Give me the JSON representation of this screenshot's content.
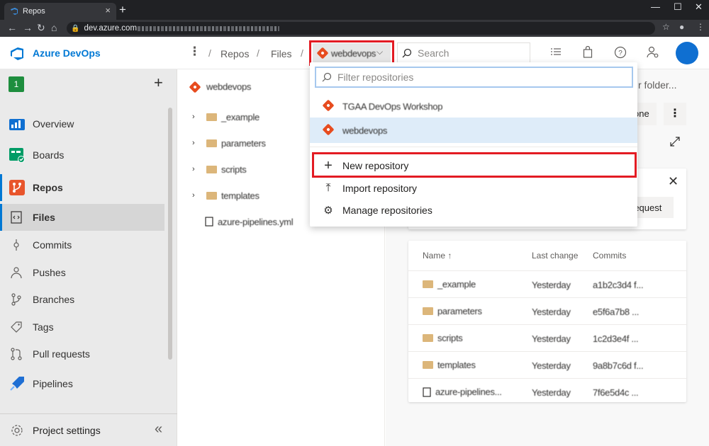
{
  "browser": {
    "tab_title": "Repos",
    "url_prefix": "dev.azure.com",
    "close_glyph": "×",
    "newtab_glyph": "+",
    "minimize": "—",
    "maximize": "☐",
    "close_window": "✕"
  },
  "header": {
    "brand": "Azure DevOps",
    "more": "⋮",
    "crumbs": [
      "Repos",
      "Files"
    ],
    "repo_selector_label": "webdevops",
    "search_placeholder": "Search",
    "icons": [
      "list-icon",
      "bag-icon",
      "help-icon",
      "user-settings-icon"
    ]
  },
  "sidebar": {
    "project_badge": "1",
    "add": "+",
    "items": [
      {
        "label": "Overview",
        "icon": "overview-icon"
      },
      {
        "label": "Boards",
        "icon": "boards-icon"
      },
      {
        "label": "Repos",
        "icon": "repos-icon"
      },
      {
        "label": "Files",
        "icon": "files-icon"
      },
      {
        "label": "Commits",
        "icon": "commits-icon"
      },
      {
        "label": "Pushes",
        "icon": "pushes-icon"
      },
      {
        "label": "Branches",
        "icon": "branches-icon"
      },
      {
        "label": "Tags",
        "icon": "tags-icon"
      },
      {
        "label": "Pull requests",
        "icon": "pull-requests-icon"
      },
      {
        "label": "Pipelines",
        "icon": "pipelines-icon"
      }
    ],
    "settings": "Project settings",
    "collapse": "«"
  },
  "tree": {
    "root": "webdevops",
    "nodes": [
      "_example",
      "parameters",
      "scripts",
      "templates"
    ],
    "file": "azure-pipelines.yml"
  },
  "content": {
    "path_hint": "r folder...",
    "clone_label": "one",
    "request_label": "request",
    "table": {
      "headers": [
        "Name",
        "Last change",
        "Commits"
      ],
      "sort_glyph": "↑",
      "rows": [
        {
          "name": "_example",
          "last": "Yesterday",
          "commit": "a1b2c3d4 f..."
        },
        {
          "name": "parameters",
          "last": "Yesterday",
          "commit": "e5f6a7b8 ..."
        },
        {
          "name": "scripts",
          "last": "Yesterday",
          "commit": "1c2d3e4f ..."
        },
        {
          "name": "templates",
          "last": "Yesterday",
          "commit": "9a8b7c6d f..."
        },
        {
          "name": "azure-pipelines...",
          "last": "Yesterday",
          "commit": "7f6e5d4c ..."
        }
      ]
    }
  },
  "dropdown": {
    "filter_placeholder": "Filter repositories",
    "repos": [
      "TGAA DevOps Workshop",
      "webdevops"
    ],
    "actions": [
      {
        "label": "New repository",
        "icon": "plus-icon",
        "glyph": "+"
      },
      {
        "label": "Import repository",
        "icon": "import-icon",
        "glyph": "⤒"
      },
      {
        "label": "Manage repositories",
        "icon": "gear-icon",
        "glyph": "⚙"
      }
    ]
  },
  "colors": {
    "accent": "#0078d4",
    "highlight": "#e31b23",
    "git": "#e74c1f",
    "selected": "#deecf9"
  }
}
